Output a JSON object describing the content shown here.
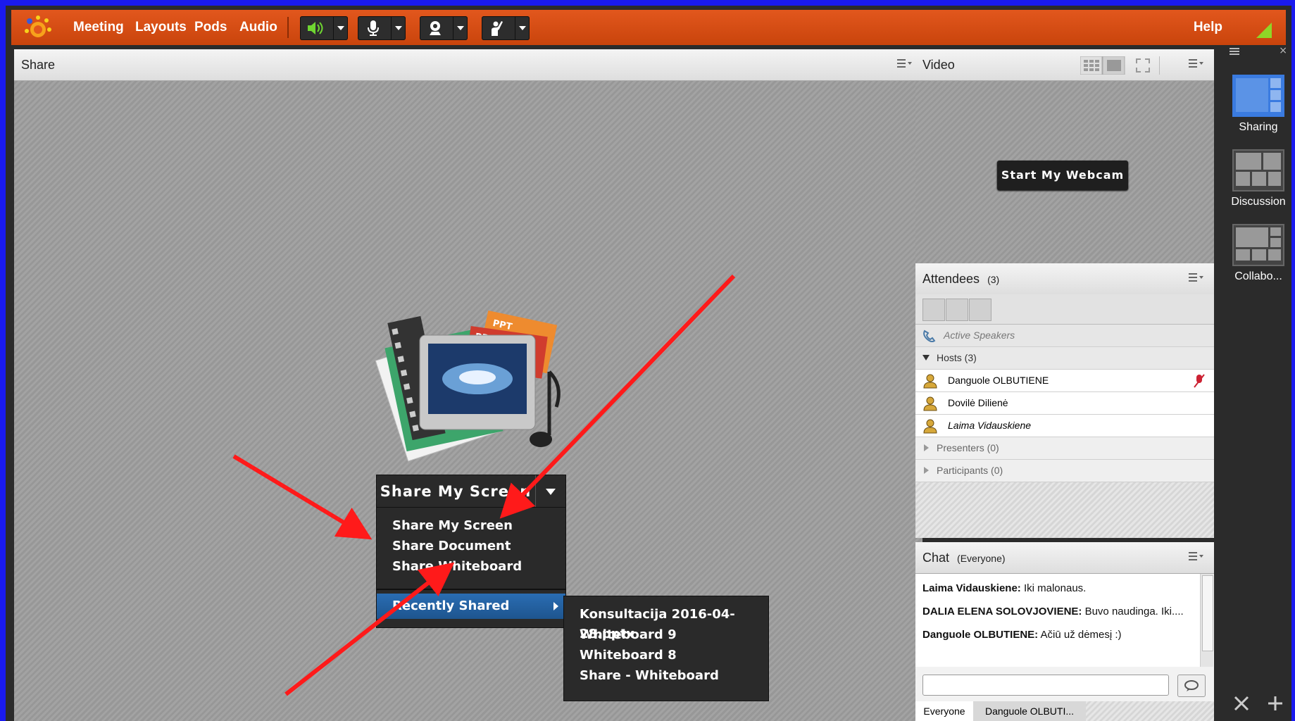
{
  "menubar": {
    "items": [
      "Meeting",
      "Layouts",
      "Pods",
      "Audio"
    ],
    "help": "Help"
  },
  "share_pod": {
    "title": "Share",
    "button_label": "Share My Screen",
    "menu": [
      "Share My Screen",
      "Share Document",
      "Share Whiteboard"
    ],
    "recently_shared": "Recently Shared",
    "submenu": [
      "Konsultacija 2016-04-28.pptx",
      "Whiteboard 9",
      "Whiteboard 8",
      "Share - Whiteboard"
    ],
    "art_labels": [
      "PPT",
      "PDF"
    ]
  },
  "video_pod": {
    "title": "Video",
    "webcam_button": "Start My Webcam"
  },
  "attendees_pod": {
    "title": "Attendees",
    "count": "(3)",
    "active_speakers": "Active Speakers",
    "hosts_label": "Hosts (3)",
    "hosts": [
      "Danguole OLBUTIENE",
      "Dovilė Dilienė",
      "Laima Vidauskiene"
    ],
    "presenters_label": "Presenters (0)",
    "participants_label": "Participants (0)"
  },
  "chat_pod": {
    "title": "Chat",
    "scope": "(Everyone)",
    "messages": [
      {
        "author": "Laima Vidauskiene:",
        "text": " Iki malonaus."
      },
      {
        "author": "DALIA ELENA SOLOVJOVIENE:",
        "text": " Buvo naudinga. Iki...."
      },
      {
        "author": "Danguole OLBUTIENE:",
        "text": " Ačiū už dėmesį :)"
      }
    ],
    "input_value": "",
    "tabs": [
      "Everyone",
      "Danguole OLBUTI..."
    ]
  },
  "layouts_bar": {
    "items": [
      "Sharing",
      "Discussion",
      "Collabo..."
    ]
  },
  "colors": {
    "accent_orange": "#d44d12",
    "frame_blue": "#1a1aee",
    "menu_highlight": "#2a6db3",
    "annotation_red": "#ff1a1a"
  }
}
